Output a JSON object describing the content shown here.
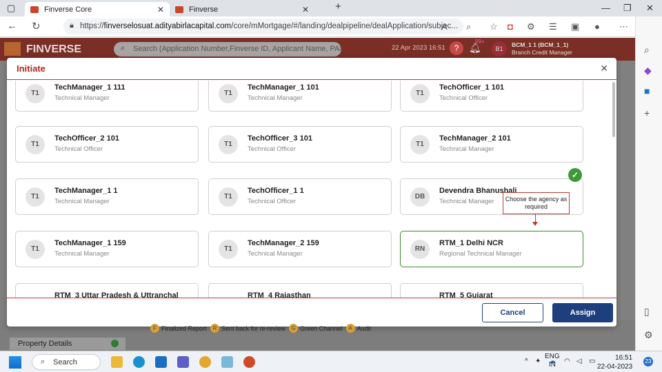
{
  "browser": {
    "tabs": [
      {
        "title": "Finverse Core"
      },
      {
        "title": "Finverse"
      }
    ],
    "new_tab": "+",
    "url_prefix": "https://",
    "url_domain": "finverselosuat.adityabirlacapital.com",
    "url_path": "/core/mMortgage/#/landing/dealpipeline/dealApplication/subjec..."
  },
  "app": {
    "brand": "FINVERSE",
    "search_placeholder": "Search (Application Number,Finverse ID, Applicant Name, PAN Number)",
    "date": "22 Apr 2023 16:51",
    "notif_count": "99+",
    "avatar": "B1",
    "user_name": "BCM_1 1 (BCM_1_1)",
    "user_role": "Branch Credit Manager",
    "legend": [
      {
        "code": "F",
        "label": "Finalized Report"
      },
      {
        "code": "R",
        "label": "Sent back for re-review"
      },
      {
        "code": "G",
        "label": "Green Channel"
      },
      {
        "code": "A",
        "label": "Audit"
      }
    ],
    "property_details": "Property Details"
  },
  "modal": {
    "title": "Initiate",
    "cards": [
      {
        "initials": "T1",
        "name": "TechManager_1 111",
        "role": "Technical Manager"
      },
      {
        "initials": "T1",
        "name": "TechManager_1 101",
        "role": "Technical Manager"
      },
      {
        "initials": "T1",
        "name": "TechOfficer_1 101",
        "role": "Technical Officer"
      },
      {
        "initials": "T1",
        "name": "TechOfficer_2 101",
        "role": "Technical Officer"
      },
      {
        "initials": "T1",
        "name": "TechOfficer_3 101",
        "role": "Technical Officer"
      },
      {
        "initials": "T1",
        "name": "TechManager_2 101",
        "role": "Technical Manager"
      },
      {
        "initials": "T1",
        "name": "TechManager_1 1",
        "role": "Technical Manager"
      },
      {
        "initials": "T1",
        "name": "TechOfficer_1 1",
        "role": "Technical Officer"
      },
      {
        "initials": "DB",
        "name": "Devendra Bhanushali",
        "role": "Technical Manager"
      },
      {
        "initials": "T1",
        "name": "TechManager_1 159",
        "role": "Technical Manager"
      },
      {
        "initials": "T1",
        "name": "TechManager_2 159",
        "role": "Technical Manager"
      },
      {
        "initials": "RN",
        "name": "RTM_1 Delhi NCR",
        "role": "Regional Technical Manager"
      },
      {
        "initials": "",
        "name": "RTM_3 Uttar Pradesh & Uttranchal",
        "role": ""
      },
      {
        "initials": "",
        "name": "RTM_4 Rajasthan",
        "role": ""
      },
      {
        "initials": "",
        "name": "RTM_5 Gujarat",
        "role": ""
      }
    ],
    "callout": "Choose the agency as required",
    "cancel": "Cancel",
    "assign": "Assign"
  },
  "taskbar": {
    "search": "Search",
    "lang_line1": "ENG",
    "lang_line2": "IN",
    "time": "16:51",
    "date": "22-04-2023",
    "notif": "23"
  }
}
